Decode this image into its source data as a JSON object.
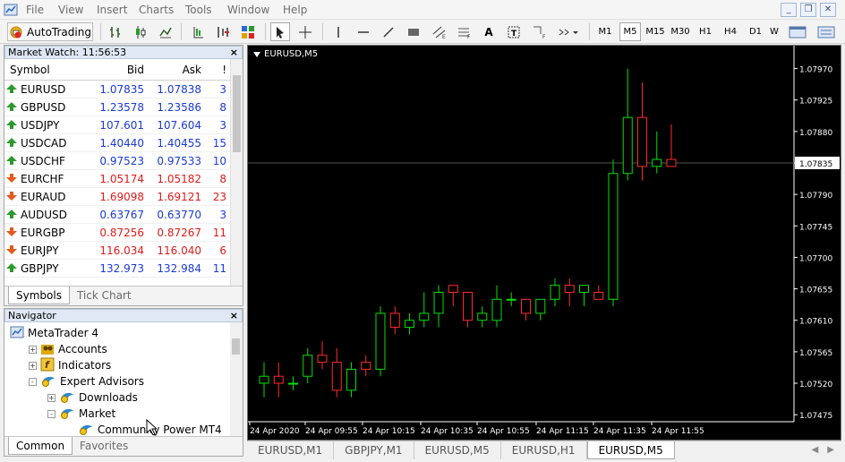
{
  "menu": [
    "File",
    "View",
    "Insert",
    "Charts",
    "Tools",
    "Window",
    "Help"
  ],
  "toolbar": {
    "autotrading_label": "AutoTrading",
    "timeframes": [
      "M1",
      "M5",
      "M15",
      "M30",
      "H1",
      "H4",
      "D1",
      "W"
    ],
    "active_timeframe": "M5"
  },
  "market_watch": {
    "title": "Market Watch: 11:56:53",
    "columns": {
      "symbol": "Symbol",
      "bid": "Bid",
      "ask": "Ask",
      "spread": "!"
    },
    "rows": [
      {
        "symbol": "EURUSD",
        "bid": "1.07835",
        "ask": "1.07838",
        "spread": "3",
        "dir": "up"
      },
      {
        "symbol": "GBPUSD",
        "bid": "1.23578",
        "ask": "1.23586",
        "spread": "8",
        "dir": "up"
      },
      {
        "symbol": "USDJPY",
        "bid": "107.601",
        "ask": "107.604",
        "spread": "3",
        "dir": "up"
      },
      {
        "symbol": "USDCAD",
        "bid": "1.40440",
        "ask": "1.40455",
        "spread": "15",
        "dir": "up"
      },
      {
        "symbol": "USDCHF",
        "bid": "0.97523",
        "ask": "0.97533",
        "spread": "10",
        "dir": "up"
      },
      {
        "symbol": "EURCHF",
        "bid": "1.05174",
        "ask": "1.05182",
        "spread": "8",
        "dir": "down"
      },
      {
        "symbol": "EURAUD",
        "bid": "1.69098",
        "ask": "1.69121",
        "spread": "23",
        "dir": "down"
      },
      {
        "symbol": "AUDUSD",
        "bid": "0.63767",
        "ask": "0.63770",
        "spread": "3",
        "dir": "up"
      },
      {
        "symbol": "EURGBP",
        "bid": "0.87256",
        "ask": "0.87267",
        "spread": "11",
        "dir": "down"
      },
      {
        "symbol": "EURJPY",
        "bid": "116.034",
        "ask": "116.040",
        "spread": "6",
        "dir": "down"
      },
      {
        "symbol": "GBPJPY",
        "bid": "132.973",
        "ask": "132.984",
        "spread": "11",
        "dir": "up"
      }
    ],
    "tabs": [
      "Symbols",
      "Tick Chart"
    ],
    "active_tab": "Symbols"
  },
  "navigator": {
    "title": "Navigator",
    "items": [
      {
        "label": "MetaTrader 4",
        "level": 0,
        "expander": ""
      },
      {
        "label": "Accounts",
        "level": 1,
        "expander": "+"
      },
      {
        "label": "Indicators",
        "level": 1,
        "expander": "+"
      },
      {
        "label": "Expert Advisors",
        "level": 1,
        "expander": "-"
      },
      {
        "label": "Downloads",
        "level": 2,
        "expander": "+"
      },
      {
        "label": "Market",
        "level": 2,
        "expander": "-"
      },
      {
        "label": "Community Power MT4",
        "level": 3,
        "expander": ""
      }
    ],
    "tabs": [
      "Common",
      "Favorites"
    ],
    "active_tab": "Common"
  },
  "chart": {
    "title": "EURUSD,M5",
    "current_price": "1.07835",
    "price_labels": [
      "1.07970",
      "1.07925",
      "1.07880",
      "1.07835",
      "1.07790",
      "1.07745",
      "1.07700",
      "1.07655",
      "1.07610",
      "1.07565",
      "1.07520",
      "1.07475"
    ],
    "time_labels": [
      "24 Apr 2020",
      "24 Apr 09:55",
      "24 Apr 10:15",
      "24 Apr 10:35",
      "24 Apr 10:55",
      "24 Apr 11:15",
      "24 Apr 11:35",
      "24 Apr 11:55"
    ],
    "colors": {
      "bull": "#00e000",
      "bear": "#ff2a2a",
      "axis": "#ffffff",
      "bg": "#000000"
    }
  },
  "chart_tabs": [
    "EURUSD,M1",
    "GBPJPY,M1",
    "EURUSD,M5",
    "EURUSD,H1",
    "EURUSD,M5"
  ],
  "active_chart_tab": 4,
  "chart_data": {
    "type": "candlestick",
    "symbol": "EURUSD",
    "timeframe": "M5",
    "ylim": [
      1.07465,
      1.07995
    ],
    "candles": [
      {
        "o": 1.0752,
        "h": 1.0755,
        "l": 1.075,
        "c": 1.0753
      },
      {
        "o": 1.0753,
        "h": 1.0755,
        "l": 1.075,
        "c": 1.0752
      },
      {
        "o": 1.0752,
        "h": 1.0753,
        "l": 1.0751,
        "c": 1.0752
      },
      {
        "o": 1.0753,
        "h": 1.0757,
        "l": 1.0752,
        "c": 1.0756
      },
      {
        "o": 1.0756,
        "h": 1.0758,
        "l": 1.0754,
        "c": 1.0755
      },
      {
        "o": 1.0755,
        "h": 1.0757,
        "l": 1.075,
        "c": 1.0751
      },
      {
        "o": 1.0751,
        "h": 1.0755,
        "l": 1.075,
        "c": 1.0754
      },
      {
        "o": 1.0755,
        "h": 1.0756,
        "l": 1.0753,
        "c": 1.0754
      },
      {
        "o": 1.0754,
        "h": 1.0763,
        "l": 1.0753,
        "c": 1.0762
      },
      {
        "o": 1.0762,
        "h": 1.0763,
        "l": 1.0759,
        "c": 1.076
      },
      {
        "o": 1.076,
        "h": 1.0762,
        "l": 1.0759,
        "c": 1.0761
      },
      {
        "o": 1.0761,
        "h": 1.0765,
        "l": 1.076,
        "c": 1.0762
      },
      {
        "o": 1.0762,
        "h": 1.0766,
        "l": 1.076,
        "c": 1.0765
      },
      {
        "o": 1.0766,
        "h": 1.0766,
        "l": 1.0763,
        "c": 1.0765
      },
      {
        "o": 1.0765,
        "h": 1.0765,
        "l": 1.076,
        "c": 1.0761
      },
      {
        "o": 1.0761,
        "h": 1.0763,
        "l": 1.076,
        "c": 1.0762
      },
      {
        "o": 1.0761,
        "h": 1.0766,
        "l": 1.076,
        "c": 1.0764
      },
      {
        "o": 1.0764,
        "h": 1.0765,
        "l": 1.0763,
        "c": 1.0764
      },
      {
        "o": 1.0764,
        "h": 1.0764,
        "l": 1.0761,
        "c": 1.0762
      },
      {
        "o": 1.0762,
        "h": 1.0764,
        "l": 1.0761,
        "c": 1.0764
      },
      {
        "o": 1.0764,
        "h": 1.0767,
        "l": 1.0763,
        "c": 1.0766
      },
      {
        "o": 1.0766,
        "h": 1.0767,
        "l": 1.0763,
        "c": 1.0765
      },
      {
        "o": 1.0765,
        "h": 1.0766,
        "l": 1.0763,
        "c": 1.0766
      },
      {
        "o": 1.0765,
        "h": 1.0766,
        "l": 1.0764,
        "c": 1.0764
      },
      {
        "o": 1.0764,
        "h": 1.0784,
        "l": 1.0763,
        "c": 1.0782
      },
      {
        "o": 1.0782,
        "h": 1.0797,
        "l": 1.0781,
        "c": 1.079
      },
      {
        "o": 1.079,
        "h": 1.0795,
        "l": 1.0781,
        "c": 1.0783
      },
      {
        "o": 1.0783,
        "h": 1.0788,
        "l": 1.0782,
        "c": 1.0784
      },
      {
        "o": 1.0784,
        "h": 1.0789,
        "l": 1.0783,
        "c": 1.0783
      }
    ]
  }
}
